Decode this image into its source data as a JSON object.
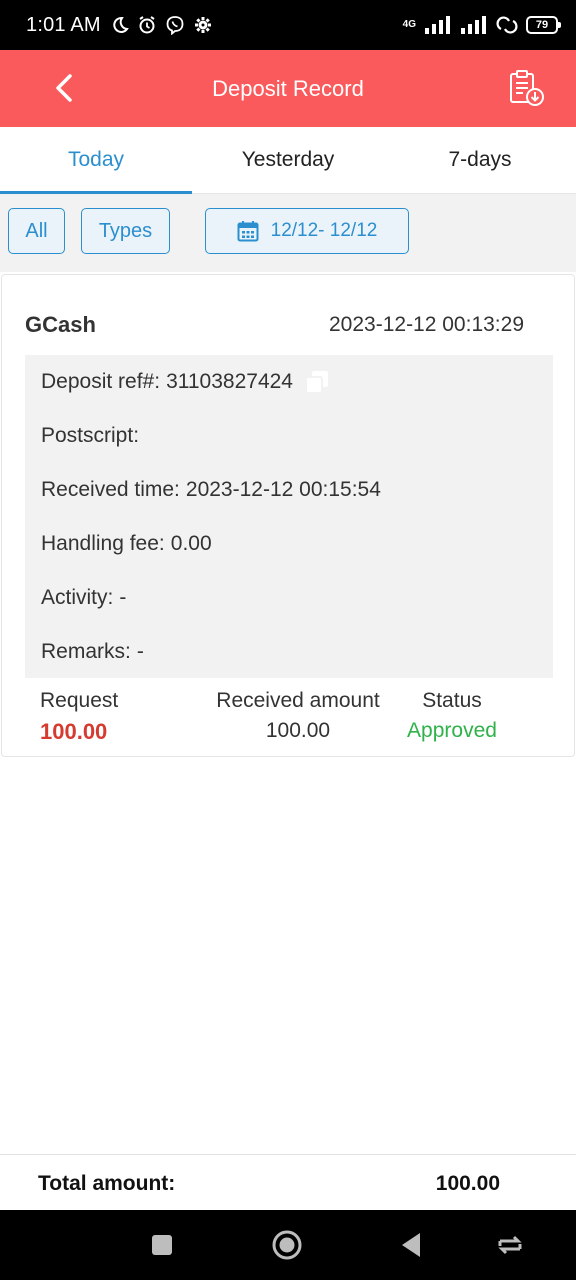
{
  "status_bar": {
    "time": "1:01 AM",
    "network_type": "4G",
    "battery": "79"
  },
  "header": {
    "title": "Deposit Record"
  },
  "tabs": [
    {
      "label": "Today",
      "active": true
    },
    {
      "label": "Yesterday",
      "active": false
    },
    {
      "label": "7-days",
      "active": false
    }
  ],
  "filters": {
    "all_label": "All",
    "types_label": "Types",
    "date_range": "12/12- 12/12"
  },
  "record": {
    "provider": "GCash",
    "datetime": "2023-12-12 00:13:29",
    "details": {
      "deposit_ref_label": "Deposit ref#:",
      "deposit_ref_value": "31103827424",
      "postscript_label": "Postscript:",
      "postscript_value": "",
      "received_time_label": "Received time:",
      "received_time_value": "2023-12-12 00:15:54",
      "handling_fee_label": "Handling fee:",
      "handling_fee_value": "0.00",
      "activity_label": "Activity:",
      "activity_value": "-",
      "remarks_label": "Remarks:",
      "remarks_value": "-"
    },
    "summary": {
      "request_label": "Request",
      "request_value": "100.00",
      "received_label": "Received amount",
      "received_value": "100.00",
      "status_label": "Status",
      "status_value": "Approved"
    }
  },
  "total": {
    "label": "Total amount:",
    "value": "100.00"
  },
  "colors": {
    "header_bg": "#fb5a5c",
    "accent": "#2b8fcf",
    "request_red": "#d63b2f",
    "approved_green": "#2fb24a"
  }
}
